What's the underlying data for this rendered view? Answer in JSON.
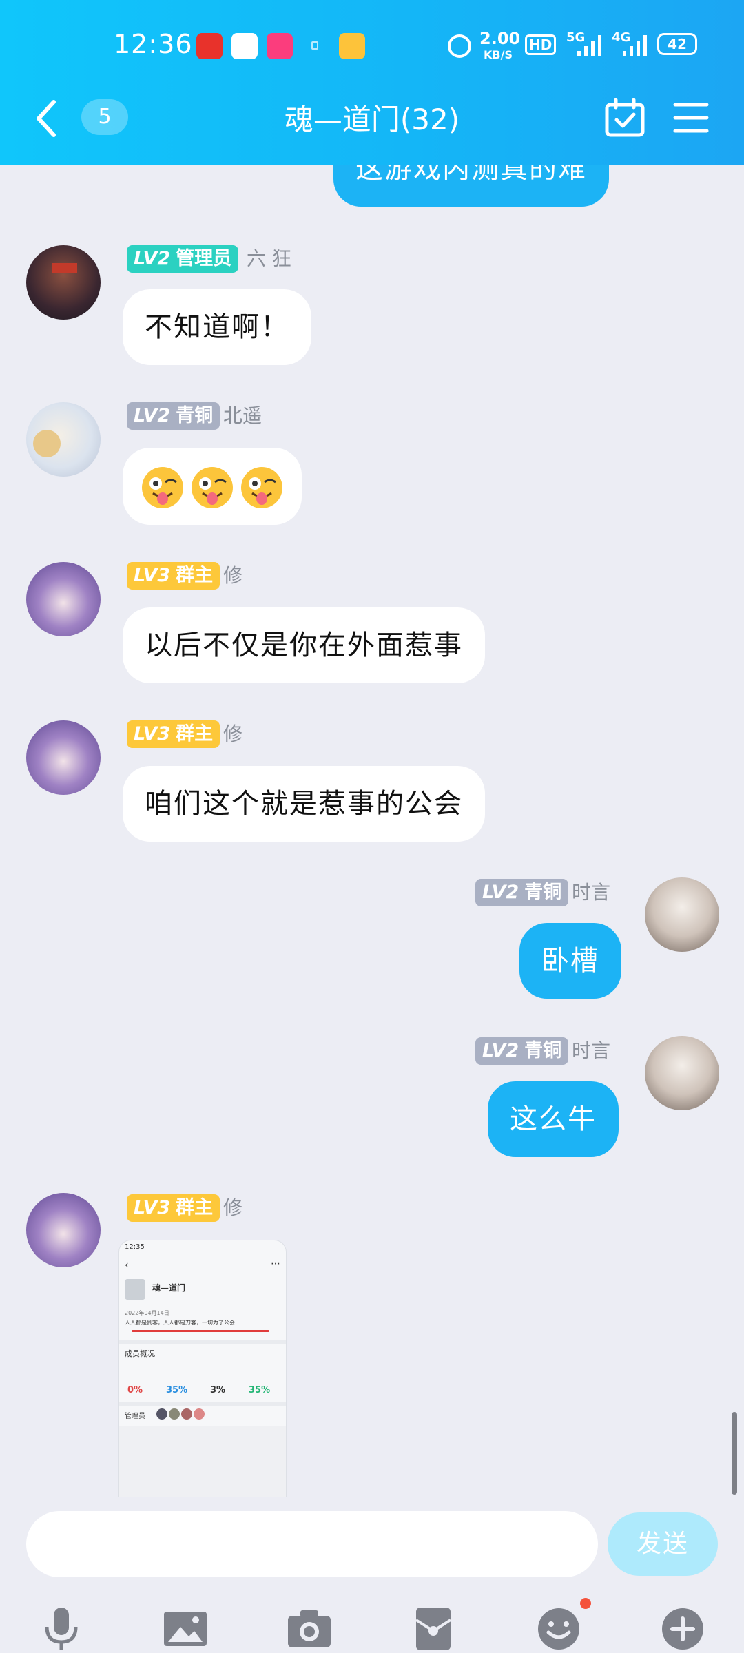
{
  "status_bar": {
    "time": "12:36",
    "net_speed": "2.00",
    "net_unit": "KB/S",
    "hd": "HD",
    "network_5g": "5G",
    "network_4g": "4G",
    "battery": "42"
  },
  "header": {
    "unread_count": "5",
    "title": "魂—道门(32)"
  },
  "messages": [
    {
      "side": "right",
      "text": "这游戏内测真的难"
    },
    {
      "side": "left",
      "level": "LV2",
      "role": "管理员",
      "sender": "六 狂",
      "text": "不知道啊！"
    },
    {
      "side": "left",
      "level": "LV2",
      "role": "青铜",
      "sender": "北遥",
      "emoji": [
        "winking-tongue-emoji",
        "winking-tongue-emoji",
        "winking-tongue-emoji"
      ]
    },
    {
      "side": "left",
      "level": "LV3",
      "role": "群主",
      "sender": "修",
      "text": "以后不仅是你在外面惹事"
    },
    {
      "side": "left",
      "level": "LV3",
      "role": "群主",
      "sender": "修",
      "text": "咱们这个就是惹事的公会"
    },
    {
      "side": "right",
      "level": "LV2",
      "role": "青铜",
      "sender": "时言",
      "text": "卧槽"
    },
    {
      "side": "right",
      "level": "LV2",
      "role": "青铜",
      "sender": "时言",
      "text": "这么牛"
    },
    {
      "side": "left",
      "level": "LV3",
      "role": "群主",
      "sender": "修",
      "image": "screenshot-thumbnail"
    }
  ],
  "thumbnail": {
    "time": "12:35",
    "group_name": "魂—道门",
    "date_line": "2022年04月14日",
    "notice": "人人都是剑客，人人都是刀客，一切为了公会",
    "section_title": "成员概况",
    "stat_values": [
      "0%",
      "35%",
      "3%",
      "35%"
    ],
    "members_label": "管理员"
  },
  "input": {
    "placeholder": "",
    "send_label": "发送"
  },
  "toolbar": [
    "mic-icon",
    "image-icon",
    "camera-icon",
    "red-packet-icon",
    "emoji-icon",
    "plus-icon"
  ],
  "colors": {
    "header": "#14b6f7",
    "bubble_self": "#1cb3f5",
    "bubble_other": "#ffffff",
    "badge_admin": "#2bd1c1",
    "badge_bronze": "#a9b0c3",
    "badge_owner": "#fdc83a",
    "send_button": "#aeeafc"
  }
}
